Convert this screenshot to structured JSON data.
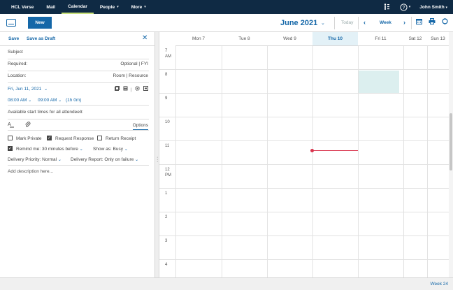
{
  "topnav": {
    "items": [
      {
        "label": "HCL Verse",
        "caret": ""
      },
      {
        "label": "Mail",
        "caret": ""
      },
      {
        "label": "Calendar",
        "caret": ""
      },
      {
        "label": "People",
        "caret": "▾"
      },
      {
        "label": "More",
        "caret": "▾"
      }
    ],
    "active_item": "Calendar",
    "user": "John Smith",
    "user_caret": "▾",
    "help_icon": "?",
    "accessibility_icon": "accessibility-icon"
  },
  "toolbar": {
    "new_label": "New",
    "month_title": "June 2021",
    "month_caret": "⌄",
    "today_label": "Today",
    "prev_arrow": "‹",
    "next_arrow": "›",
    "view_label": "Week",
    "icons": [
      "calendar-grid-icon",
      "print-icon",
      "sync-icon"
    ]
  },
  "compose": {
    "save_label": "Save",
    "save_draft_label": "Save as Draft",
    "close_label": "✕",
    "subject_placeholder": "Subject",
    "required_label": "Required:",
    "required_options": "Optional | FYI",
    "location_label": "Location:",
    "location_options": "Room | Resource",
    "date_value": "Fri, Jun 11, 2021",
    "date_caret": "⌄",
    "start_time": "08:00 AM",
    "end_time": "09:00 AM",
    "duration": "(1h 0m)",
    "time_caret": "⌄",
    "available_times": "Available start times for all attendees:",
    "available_chevron": "›",
    "format_icon": "text-format-icon",
    "attach_icon": "paperclip-icon",
    "options_label": "Options",
    "mark_private": "Mark Private",
    "mark_private_checked": false,
    "request_response": "Request Response",
    "request_response_checked": true,
    "return_receipt": "Return Receipt",
    "return_receipt_checked": false,
    "remind_me": "Remind me: 30 minutes before",
    "remind_me_checked": true,
    "show_as": "Show as: Busy",
    "delivery_priority": "Delivery Priority: Normal",
    "delivery_report": "Delivery Report: Only on failure",
    "description_placeholder": "Add description here..."
  },
  "calendar": {
    "days": [
      "Mon 7",
      "Tue 8",
      "Wed 9",
      "Thu 10",
      "Fri 11",
      "Sat 12",
      "Sun 13"
    ],
    "today_index": 3,
    "hours": [
      {
        "h": "7",
        "ampm": "AM"
      },
      {
        "h": "8",
        "ampm": ""
      },
      {
        "h": "9",
        "ampm": ""
      },
      {
        "h": "10",
        "ampm": ""
      },
      {
        "h": "11",
        "ampm": ""
      },
      {
        "h": "12",
        "ampm": "PM"
      },
      {
        "h": "1",
        "ampm": ""
      },
      {
        "h": "2",
        "ampm": ""
      },
      {
        "h": "3",
        "ampm": ""
      },
      {
        "h": "4",
        "ampm": ""
      }
    ],
    "event_color": "#dcefef",
    "now_color": "#d9344d"
  },
  "footer": {
    "week_label": "Week 24"
  },
  "colors": {
    "nav_bg": "#0f2a44",
    "accent": "#1467a8",
    "active_underline": "#c8e07a"
  }
}
